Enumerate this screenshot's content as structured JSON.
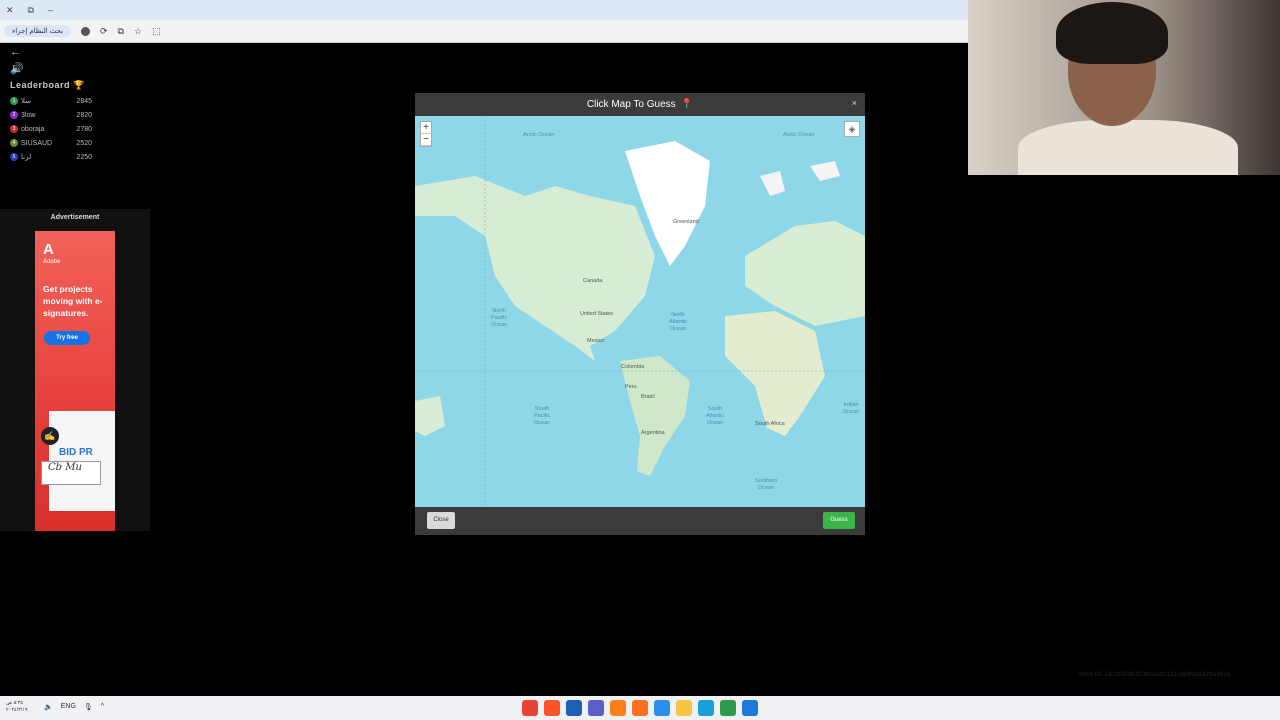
{
  "browser": {
    "tab_controls": [
      "✕",
      "⧉",
      "–"
    ],
    "profile_label": "بحث النظام إجراء",
    "toolbar_icons": [
      "refresh-icon",
      "star-icon",
      "extension-icon"
    ]
  },
  "game": {
    "back_glyph": "←",
    "sound_glyph": "🔊",
    "leaderboard_title": "Leaderboard",
    "leaderboard_trophy": "🏆",
    "leaderboard": [
      {
        "rank": "1",
        "name": "سلا",
        "score": "2845",
        "color": "#2e9b4a"
      },
      {
        "rank": "2",
        "name": "3low",
        "score": "2820",
        "color": "#8a2bd8"
      },
      {
        "rank": "3",
        "name": "oboraja",
        "score": "2780",
        "color": "#c03030"
      },
      {
        "rank": "4",
        "name": "SIUSAUD",
        "score": "2520",
        "color": "#6a8f2a"
      },
      {
        "rank": "5",
        "name": "لزنا",
        "score": "2250",
        "color": "#2a3fc0"
      }
    ]
  },
  "ad": {
    "header": "Advertisement",
    "brand": "Adobe",
    "headline": "Get projects moving with e-signatures.",
    "cta": "Try free",
    "doc_text": "BID PR",
    "signature": "Cb Mu"
  },
  "modal": {
    "title": "Click Map To Guess",
    "pin_glyph": "📍",
    "close_glyph": "×",
    "zoom_in": "+",
    "zoom_out": "−",
    "close_button": "Close",
    "guess_button": "Guess",
    "labels": {
      "arctic_w": "Arctic Ocean",
      "arctic_e": "Arctic Ocean",
      "greenland": "Greenland",
      "canada": "Canada",
      "us": "United States",
      "n_pacific": "North\nPacific\nOcean",
      "n_atlantic": "North\nAtlantic\nOcean",
      "s_pacific": "South\nPacific\nOcean",
      "s_atlantic": "South\nAtlantic\nOcean",
      "brasil": "Brasil",
      "argentina": "Argentina",
      "south_africa": "South Africa",
      "southern": "Southern\nOcean",
      "indian": "Indian\nOcean",
      "mexico": "Mexico",
      "colombia": "Colombia",
      "peru": "Peru"
    }
  },
  "taskbar": {
    "time": "٥:٣٥ ص",
    "date": "٢٠٢٤/٣/١٩",
    "lang": "ENG",
    "apps": [
      {
        "name": "chrome-icon",
        "color": "#e94235"
      },
      {
        "name": "brave-icon",
        "color": "#fb542b"
      },
      {
        "name": "store-icon",
        "color": "#1e5fb3"
      },
      {
        "name": "teams-icon",
        "color": "#5b5fc7"
      },
      {
        "name": "illustrator-icon",
        "color": "#ff7f18"
      },
      {
        "name": "firefox-icon",
        "color": "#ff6f1e"
      },
      {
        "name": "vscode-icon",
        "color": "#2b8ff0"
      },
      {
        "name": "folder-icon",
        "color": "#f6c445"
      },
      {
        "name": "edge-icon",
        "color": "#1aa0d8"
      },
      {
        "name": "chrome-dev-icon",
        "color": "#2e9b4a"
      },
      {
        "name": "windows-icon",
        "color": "#1d7ad6"
      }
    ]
  },
  "video_id": "Video ID: 13c1b203fc3f1bd1a2b21d1c3e9f0a1d3f1e161e"
}
